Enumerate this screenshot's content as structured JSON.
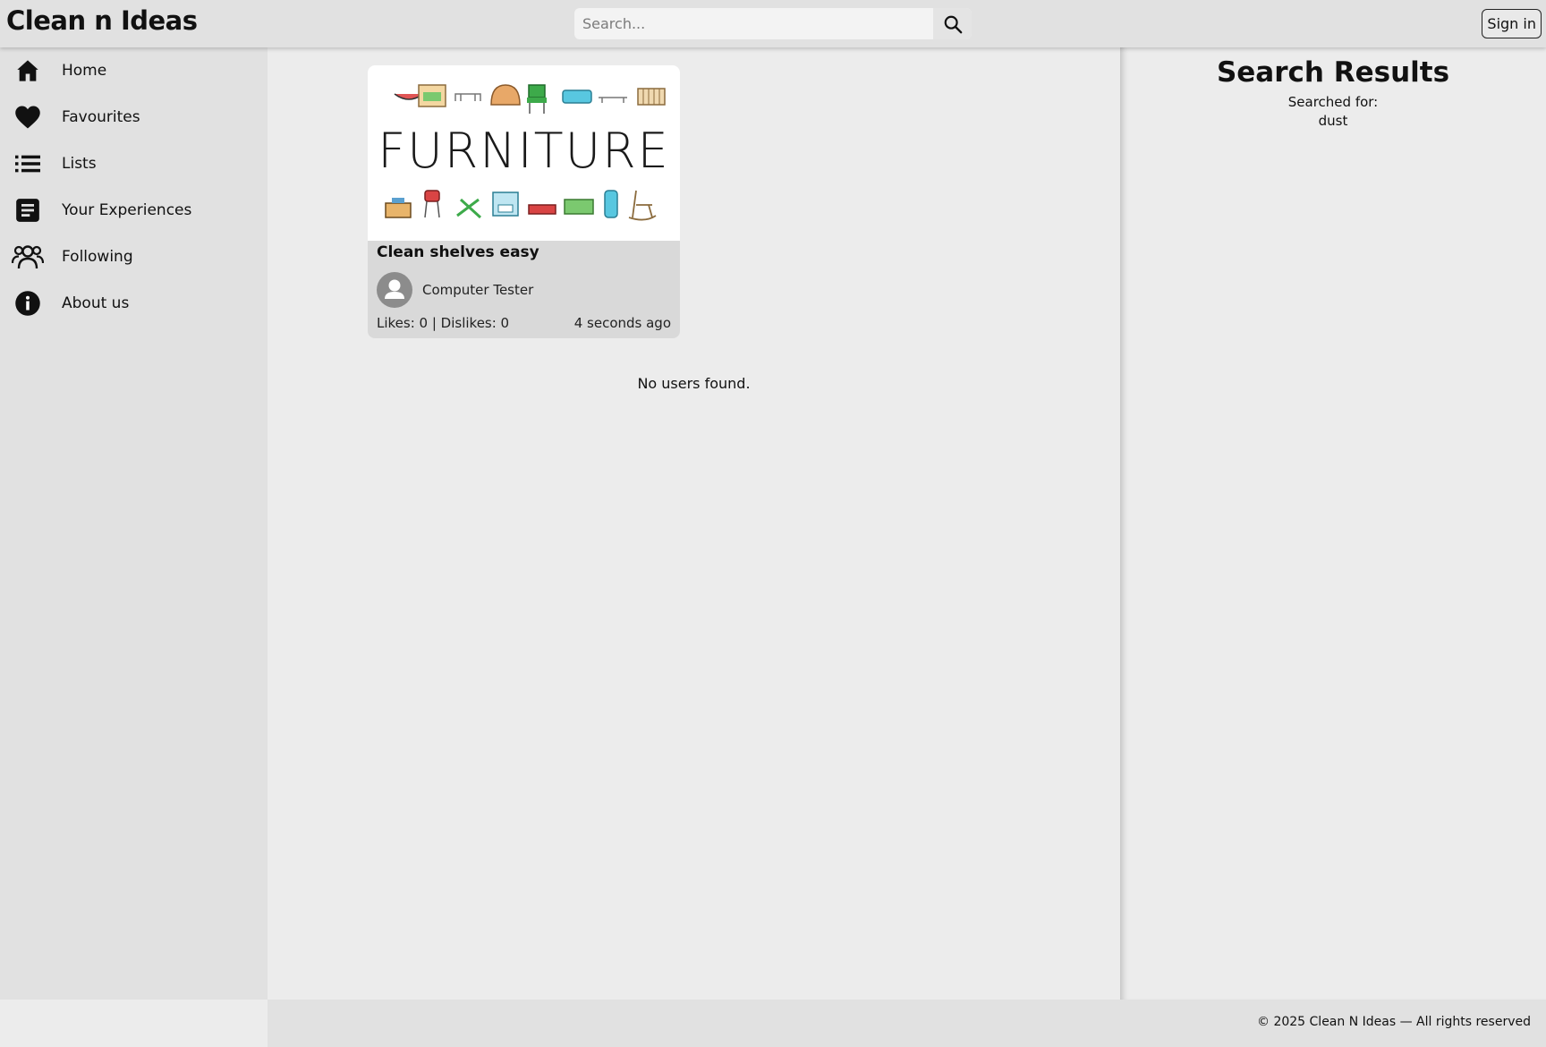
{
  "app": {
    "title": "Clean n Ideas"
  },
  "header": {
    "search_placeholder": "Search...",
    "search_icon": "search-icon",
    "signin_label": "Sign in"
  },
  "sidebar": {
    "items": [
      {
        "label": "Home",
        "icon": "home-icon"
      },
      {
        "label": "Favourites",
        "icon": "heart-icon"
      },
      {
        "label": "Lists",
        "icon": "list-icon"
      },
      {
        "label": "Your Experiences",
        "icon": "document-icon"
      },
      {
        "label": "Following",
        "icon": "people-icon"
      },
      {
        "label": "About us",
        "icon": "info-icon"
      }
    ]
  },
  "main": {
    "card": {
      "image_text": "FURNITURE",
      "title": "Clean shelves easy",
      "author": "Computer Tester",
      "stats": "Likes: 0 | Dislikes: 0",
      "time": "4 seconds ago"
    },
    "no_users": "No users found."
  },
  "results": {
    "heading": "Search Results",
    "searched_label": "Searched for:",
    "searched_term": "dust"
  },
  "footer": {
    "copyright": "© 2025 Clean N Ideas — All rights reserved"
  },
  "colors": {
    "header_bg": "#e1e1e1",
    "page_bg": "#ececec",
    "card_bg": "#d9d9d9"
  }
}
